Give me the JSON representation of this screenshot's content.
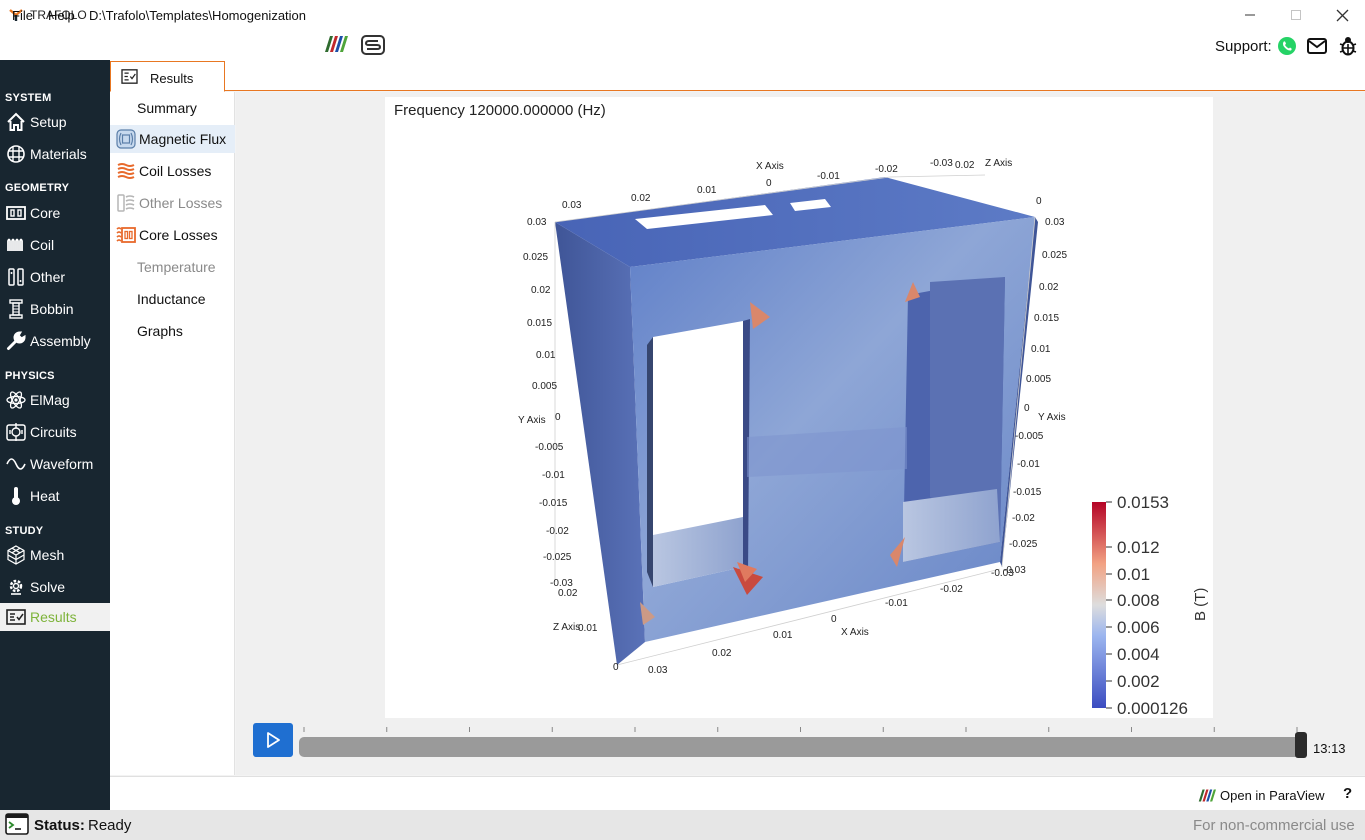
{
  "window": {
    "title": "TRAFOLO"
  },
  "menu": {
    "file": "File",
    "help": "Help",
    "path": "D:\\Trafolo\\Templates\\Homogenization"
  },
  "support": {
    "label": "Support:"
  },
  "sidebar": {
    "sections": [
      {
        "title": "SYSTEM",
        "items": [
          {
            "label": "Setup",
            "icon": "home-icon"
          },
          {
            "label": "Materials",
            "icon": "grid-icon"
          }
        ]
      },
      {
        "title": "GEOMETRY",
        "items": [
          {
            "label": "Core",
            "icon": "core-icon"
          },
          {
            "label": "Coil",
            "icon": "coil-icon"
          },
          {
            "label": "Other",
            "icon": "other-icon"
          },
          {
            "label": "Bobbin",
            "icon": "bobbin-icon"
          },
          {
            "label": "Assembly",
            "icon": "wrench-icon"
          }
        ]
      },
      {
        "title": "PHYSICS",
        "items": [
          {
            "label": "ElMag",
            "icon": "atom-icon"
          },
          {
            "label": "Circuits",
            "icon": "circuit-icon"
          },
          {
            "label": "Waveform",
            "icon": "sine-icon"
          },
          {
            "label": "Heat",
            "icon": "thermometer-icon"
          }
        ]
      },
      {
        "title": "STUDY",
        "items": [
          {
            "label": "Mesh",
            "icon": "mesh-icon"
          },
          {
            "label": "Solve",
            "icon": "solve-gear-icon"
          },
          {
            "label": "Results",
            "icon": "results-icon"
          }
        ]
      }
    ],
    "active": "Results",
    "active_color": "#7db33a"
  },
  "tab": {
    "label": "Results"
  },
  "results_nav": [
    {
      "label": "Summary",
      "icon": null,
      "state": "normal"
    },
    {
      "label": "Magnetic Flux",
      "icon": "magnetic-flux-icon",
      "state": "active"
    },
    {
      "label": "Coil Losses",
      "icon": "coil-losses-icon",
      "state": "normal"
    },
    {
      "label": "Other Losses",
      "icon": "other-losses-icon",
      "state": "disabled"
    },
    {
      "label": "Core Losses",
      "icon": "core-losses-icon",
      "state": "normal"
    },
    {
      "label": "Temperature",
      "icon": null,
      "state": "disabled"
    },
    {
      "label": "Inductance",
      "icon": null,
      "state": "normal"
    },
    {
      "label": "Graphs",
      "icon": null,
      "state": "normal"
    }
  ],
  "viewer": {
    "title": "Frequency 120000.000000 (Hz)",
    "x_axis": {
      "label": "X Axis",
      "ticks_top": [
        "0.03",
        "0.02",
        "0.01",
        "0",
        "-0.01",
        "-0.02",
        "-0.03"
      ],
      "ticks_bottom": [
        "0.03",
        "0.02",
        "0.01",
        "0",
        "-0.01",
        "-0.02",
        "-0.03"
      ]
    },
    "y_axis": {
      "label": "Y Axis",
      "ticks": [
        "0.03",
        "0.025",
        "0.02",
        "0.015",
        "0.01",
        "0.005",
        "0",
        "-0.005",
        "-0.01",
        "-0.015",
        "-0.02",
        "-0.025",
        "-0.03"
      ]
    },
    "z_axis": {
      "label": "Z Axis",
      "ticks_top": [
        "0.02",
        "0"
      ],
      "ticks_bottom": [
        "0.02",
        "0.01",
        "0"
      ]
    },
    "colorbar": {
      "title": "B (T)",
      "labels": [
        "0.0153",
        "0.012",
        "0.01",
        "0.008",
        "0.006",
        "0.004",
        "0.002",
        "0.000126"
      ],
      "color_low": "#3b4cc0",
      "color_mid": "#dddddd",
      "color_high": "#b40426"
    }
  },
  "playback": {
    "time": "13:13",
    "progress": 1.0,
    "tick_count": 13,
    "button_color": "#1f6fd1"
  },
  "actions": {
    "open_paraview": "Open in ParaView",
    "help": "?"
  },
  "status": {
    "label": "Status:",
    "value": "Ready",
    "license": "For non-commercial use"
  },
  "accent_color": "#e87722"
}
